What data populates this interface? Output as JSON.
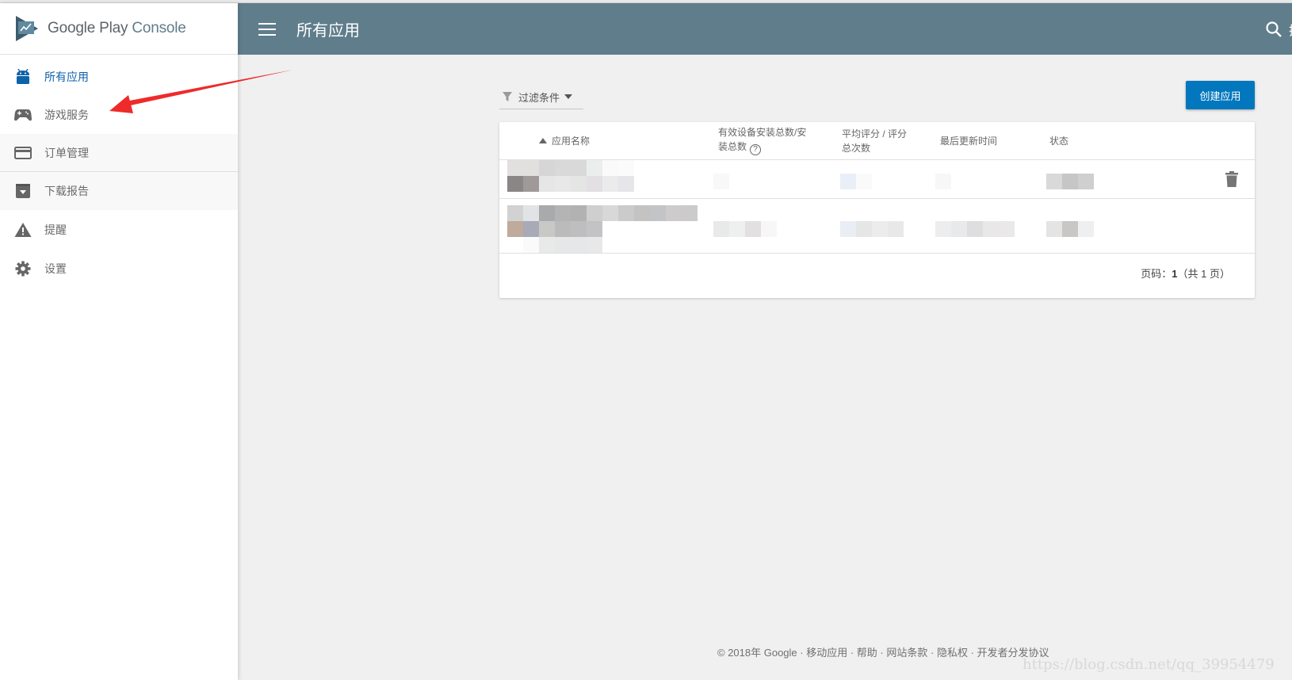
{
  "app": {
    "brand_primary": "Google Play",
    "brand_secondary": "Console",
    "colors": {
      "appbar": "#607d8b",
      "accent": "#0277bd",
      "active_nav": "#0e62a8",
      "annotation_arrow": "#ee2a2a"
    }
  },
  "sidebar": {
    "items": [
      {
        "label": "所有应用",
        "icon": "android-icon",
        "active": true
      },
      {
        "label": "游戏服务",
        "icon": "gamepad-icon",
        "active": false
      },
      {
        "label": "订单管理",
        "icon": "credit-card-icon",
        "active": false
      },
      {
        "label": "下载报告",
        "icon": "download-box-icon",
        "active": false
      },
      {
        "label": "提醒",
        "icon": "warning-icon",
        "active": false
      },
      {
        "label": "设置",
        "icon": "gear-icon",
        "active": false
      }
    ]
  },
  "header": {
    "title": "所有应用",
    "menu_icon": "hamburger-icon",
    "search_icon": "search-icon",
    "search_label": "搜"
  },
  "toolbar": {
    "filter_label": "过滤条件",
    "create_label": "创建应用"
  },
  "table": {
    "columns": [
      {
        "label": "应用名称",
        "sorted": "ascending"
      },
      {
        "label": "有效设备安装总数/安装总数",
        "help": true
      },
      {
        "label": "平均评分 / 评分总次数"
      },
      {
        "label": "最后更新时间"
      },
      {
        "label": "状态"
      }
    ],
    "rows": [
      {
        "app_name": "[redacted]",
        "installs": "[redacted]",
        "rating": "[redacted]",
        "updated": "[redacted]",
        "status": "[redacted]",
        "action_icon": "trash-icon"
      },
      {
        "app_name": "[redacted]",
        "installs": "[redacted]",
        "rating": "[redacted]",
        "updated": "[redacted]",
        "status": "[redacted]"
      }
    ],
    "pagination": {
      "prefix": "页码：",
      "current": "1",
      "total_text": "（共 1 页）"
    }
  },
  "footer": {
    "copyright": "© 2018年 Google",
    "links": [
      "移动应用",
      "帮助",
      "网站条款",
      "隐私权",
      "开发者分发协议"
    ]
  },
  "watermark": "https://blog.csdn.net/qq_39954479"
}
